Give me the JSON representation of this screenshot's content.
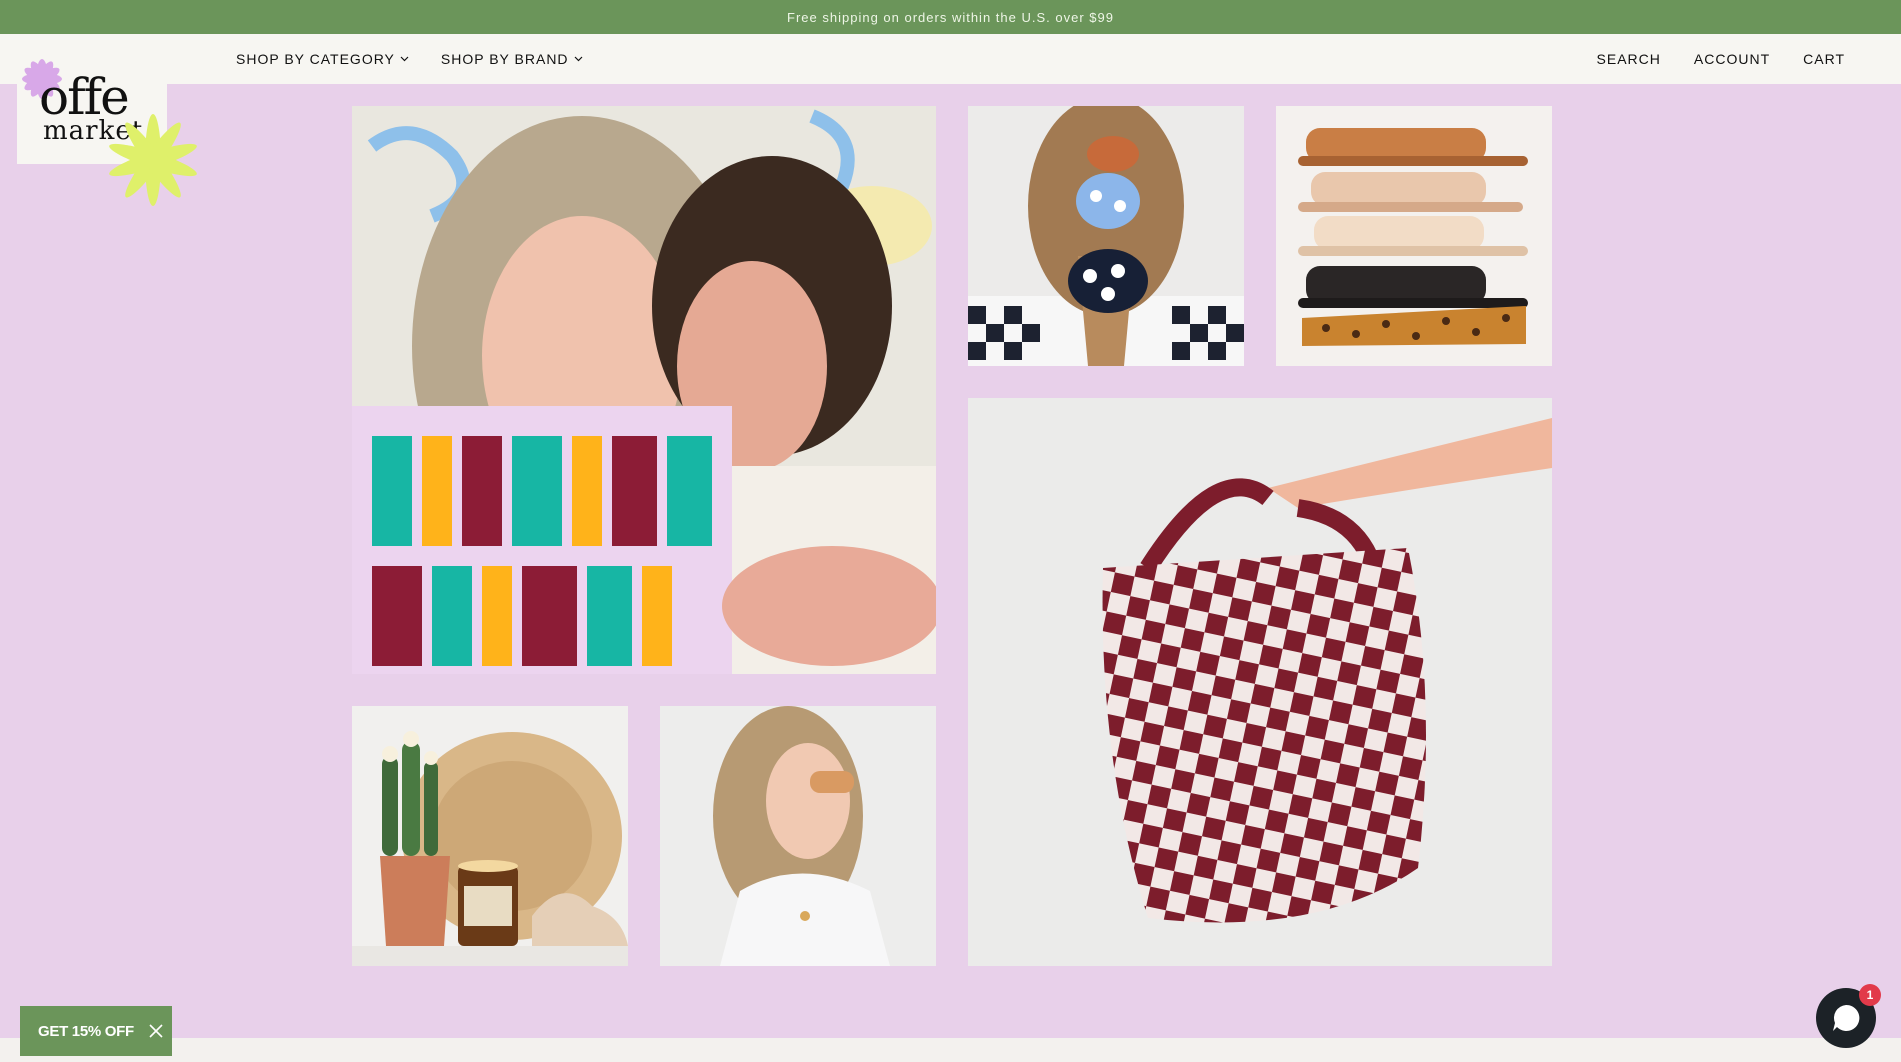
{
  "announcement": {
    "text": "Free shipping on orders within the U.S. over $99"
  },
  "logo": {
    "line1": "offe",
    "line2": "market"
  },
  "nav": {
    "left": [
      {
        "label": "SHOP BY CATEGORY",
        "has_dropdown": true
      },
      {
        "label": "SHOP BY BRAND",
        "has_dropdown": true
      }
    ],
    "right": [
      {
        "label": "SEARCH"
      },
      {
        "label": "ACCOUNT"
      },
      {
        "label": "CART"
      }
    ]
  },
  "gallery": [
    {
      "name": "two-women-portrait"
    },
    {
      "name": "floral-scrunchies-ponytail"
    },
    {
      "name": "stacked-slide-sandals"
    },
    {
      "name": "checkered-tote-bag"
    },
    {
      "name": "cactus-candle-basket-shelf"
    },
    {
      "name": "woman-in-sunglasses"
    }
  ],
  "promo": {
    "label": "GET 15% OFF"
  },
  "chat": {
    "badge_count": "1"
  },
  "colors": {
    "page_background": "#e8d0ea",
    "announcement_bar": "#6b955a",
    "header_background": "#f7f6f2",
    "promo_background": "#6b955a",
    "chat_badge": "#e23a4a"
  }
}
